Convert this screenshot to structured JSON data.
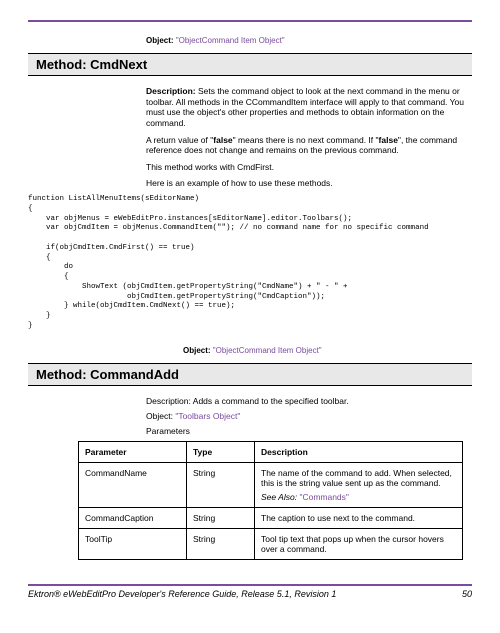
{
  "object_ref1": {
    "label": "Object:",
    "link": "\"ObjectCommand Item Object\""
  },
  "method1": {
    "heading": "Method: CmdNext",
    "desc_label": "Description:",
    "desc_text": " Sets the command object to look at the next command in the menu or toolbar. All methods in the CCommandItem interface will apply to that command. You must use the object's other properties and methods to obtain information on the command.",
    "p2a": "A return value of \"",
    "p2b": "false",
    "p2c": "\" means there is no next command. If \"",
    "p2d": "false",
    "p2e": "\", the command reference does not change and remains on the previous command.",
    "p3": "This method works with CmdFirst.",
    "p4": "Here is an example of how to use these methods.",
    "code": "function ListAllMenuItems(sEditorName)\n{\n    var objMenus = eWebEditPro.instances[sEditorName].editor.Toolbars();\n    var objCmdItem = objMenus.CommandItem(\"\"); // no command name for no specific command\n\n    if(objCmdItem.CmdFirst() == true)\n    {\n        do\n        {\n            ShowText (objCmdItem.getPropertyString(\"CmdName\") + \" - \" +\n                      objCmdItem.getPropertyString(\"CmdCaption\"));\n        } while(objCmdItem.CmdNext() == true);\n    }\n}"
  },
  "object_ref2": {
    "label": "Object:",
    "link": "\"ObjectCommand Item Object\""
  },
  "method2": {
    "heading": "Method: CommandAdd",
    "desc_label": "Description:",
    "desc_text": " Adds a command to the specified toolbar.",
    "obj_label": "Object:",
    "obj_link": "\"Toolbars Object\"",
    "param_heading": "Parameters"
  },
  "table": {
    "headers": {
      "c1": "Parameter",
      "c2": "Type",
      "c3": "Description"
    },
    "rows": [
      {
        "c1": "CommandName",
        "c2": "String",
        "c3": "The name of the command to add. When selected, this is the string value sent up as the command.",
        "see_label": "See Also: ",
        "see_link": "\"Commands\""
      },
      {
        "c1": "CommandCaption",
        "c2": "String",
        "c3": "The caption to use next to the command."
      },
      {
        "c1": "ToolTip",
        "c2": "String",
        "c3": "Tool tip text that pops up when the cursor hovers over a command."
      }
    ]
  },
  "footer": {
    "left": "Ektron® eWebEditPro Developer's Reference Guide, Release 5.1, Revision 1",
    "right": "50"
  }
}
